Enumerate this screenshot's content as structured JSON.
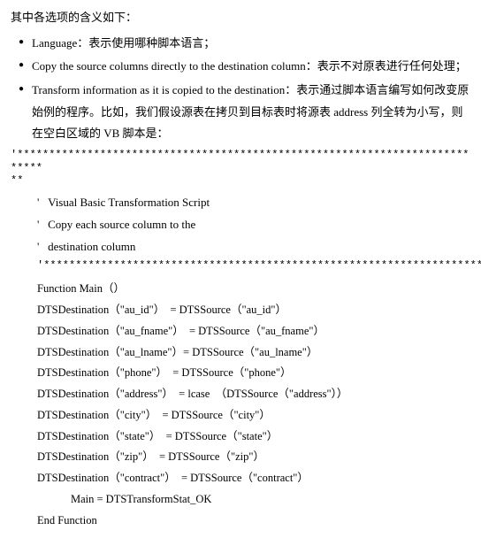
{
  "intro": "其中各选项的含义如下：",
  "bullets": [
    {
      "text": "Language：表示使用哪种脚本语言；"
    },
    {
      "text": "Copy the source columns directly to the destination column：表示不对原表进行任何处理；"
    },
    {
      "text": "Transform information as it is copied to the destination：表示通过脚本语言编写如何改变原始例的程序。比如，我们假设源表在拷贝到目标表时将源表 address 列全转为小写，则在空白区域的 VB 脚本是："
    }
  ],
  "stars1": "'****************************************************************************",
  "stars_cont": "**",
  "comments": {
    "c1": "'   Visual Basic Transformation Script",
    "c2": "'   Copy each source column to the",
    "c3": "'   destination column"
  },
  "stars2": "'*********************************************************************",
  "func_header": "Function Main（）",
  "lines": [
    "DTSDestination（\"au_id\"）　= DTSSource（\"au_id\"）",
    "DTSDestination（\"au_fname\"）　= DTSSource（\"au_fname\"）",
    "DTSDestination（\"au_lname\"）= DTSSource（\"au_lname\"）",
    "DTSDestination（\"phone\"）　= DTSSource（\"phone\"）",
    "DTSDestination（\"address\"）　= lcase　（DTSSource（\"address\"））",
    "DTSDestination（\"city\"）　= DTSSource（\"city\"）",
    "DTSDestination（\"state\"）　= DTSSource（\"state\"）",
    "DTSDestination（\"zip\"）　= DTSSource（\"zip\"）",
    "DTSDestination（\"contract\"）　= DTSSource（\"contract\"）"
  ],
  "main_ok": "Main = DTSTransformStat_OK",
  "end_func": "End Function"
}
